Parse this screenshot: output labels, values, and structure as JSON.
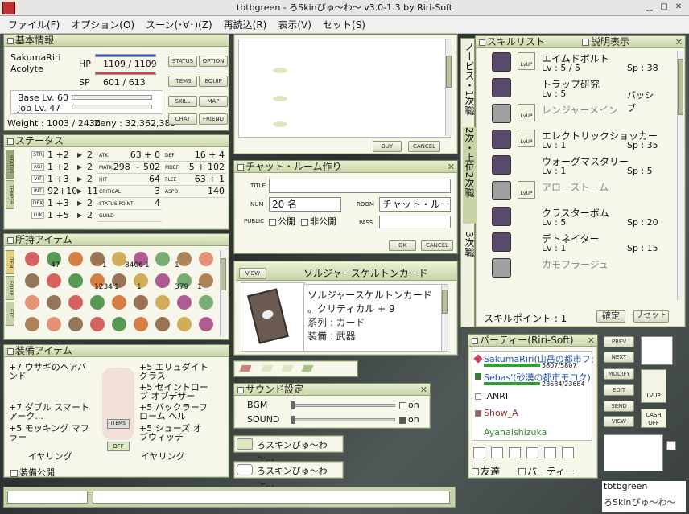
{
  "window": {
    "title": "tbtbgreen - ろSkinぴゅ～わ～ v3.0-1.3 by Riri-Soft"
  },
  "menu": [
    "ファイル(F)",
    "オプション(O)",
    "スーン(･∀･)(Z)",
    "再読込(R)",
    "表示(V)",
    "セット(S)"
  ],
  "basic": {
    "title": "基本情報",
    "name": "SakumaRiri",
    "job": "Acolyte",
    "hp_label": "HP",
    "hp": "1109 / 1109",
    "sp_label": "SP",
    "sp": "601 / 613",
    "hp_frac": 1.0,
    "sp_frac": 0.98,
    "base_lv": "Base Lv. 60",
    "job_lv": "Job Lv. 47",
    "weight": "Weight : 1003 / 2430",
    "zeny": "Zeny : 32,362,389",
    "buttons": [
      "STATUS",
      "OPTION",
      "ITEMS",
      "EQUIP",
      "SKILL",
      "MAP",
      "CHAT",
      "FRIEND"
    ]
  },
  "status": {
    "title": "ステータス",
    "tab": "STATUS",
    "tab2": "TEMPER",
    "stats": [
      {
        "k": "STR",
        "v": "1 +2",
        "p": "2"
      },
      {
        "k": "AGI",
        "v": "1 +2",
        "p": "2"
      },
      {
        "k": "VIT",
        "v": "1 +3",
        "p": "2"
      },
      {
        "k": "INT",
        "v": "92+10",
        "p": "11"
      },
      {
        "k": "DEX",
        "v": "1 +3",
        "p": "2"
      },
      {
        "k": "LUK",
        "v": "1 +5",
        "p": "2"
      }
    ],
    "left": [
      {
        "k": "ATK",
        "v": "63 + 0"
      },
      {
        "k": "MATK",
        "v": "298 ~ 502"
      },
      {
        "k": "HIT",
        "v": "64"
      },
      {
        "k": "CRITICAL",
        "v": "3"
      },
      {
        "k": "STATUS POINT",
        "v": "4"
      },
      {
        "k": "GUILD",
        "v": ""
      }
    ],
    "right": [
      {
        "k": "DEF",
        "v": "16 + 4"
      },
      {
        "k": "MDEF",
        "v": "5 + 102"
      },
      {
        "k": "FLEE",
        "v": "63 + 1"
      },
      {
        "k": "ASPD",
        "v": "140"
      }
    ]
  },
  "items": {
    "title": "所持アイテム",
    "tabs": [
      "ITEM",
      "EQUIP",
      "ETC"
    ],
    "counts": [
      "47",
      "1",
      "8406",
      "1",
      "1",
      "1234",
      "1",
      "1",
      "379",
      "1"
    ]
  },
  "equip": {
    "title": "装備アイテム",
    "left": [
      "+7 ウサギのヘアバンド",
      "+7 ダブル スマート アーク...",
      "+5 モッキング マフラー",
      "イヤリング"
    ],
    "right": [
      "+5 エリュダイト グラス",
      "+5 セイントローブ オブデザー",
      "+5 バックラーフローム ヘル",
      "+5 シューズ オブウィッチ",
      "イヤリング"
    ],
    "items_label": "ITEMS",
    "off_label": "OFF",
    "public": "装備公開"
  },
  "shop": {
    "buy": "BUY",
    "cancel": "CANCEL"
  },
  "chat": {
    "title": "チャット・ルーム作り",
    "title_label": "TITLE",
    "num_label": "NUM",
    "num": "20 名",
    "room_label": "ROOM",
    "room": "チャット・ルー",
    "public_label": "PUBLIC",
    "open": "公開",
    "closed": "非公開",
    "pass_label": "PASS",
    "ok": "OK",
    "cancel": "CANCEL"
  },
  "card": {
    "title": "ソルジャースケルトンカード",
    "view": "VIEW",
    "name": "ソルジャースケルトンカード",
    "effect": "。クリティカル + 9",
    "series": "系列 : カード",
    "slot": "装備 : 武器"
  },
  "sound": {
    "title": "サウンド設定",
    "bgm": "BGM",
    "sound": "SOUND",
    "on": "on",
    "bgm_level": 0.0,
    "sound_level": 0.0
  },
  "notes": [
    "ろスキンぴゅ～わ～...",
    "ろスキンぴゅ～わ～..."
  ],
  "skill": {
    "title": "スキルリスト",
    "desc": "説明表示",
    "tabs": [
      "ノービス・1次職",
      "2次・上位2次職",
      "3次職"
    ],
    "rows": [
      {
        "n": "エイムドボルト",
        "lv": "Lv :  5  /  5",
        "sp": "Sp : 38",
        "up": true
      },
      {
        "n": "トラップ研究",
        "lv": "Lv : 5",
        "sp": "パッシブ",
        "up": false
      },
      {
        "n": "レンジャーメイン",
        "lv": "",
        "sp": "",
        "up": true
      },
      {
        "n": "エレクトリックショッカー",
        "lv": "Lv : 1",
        "sp": "Sp : 35",
        "up": true
      },
      {
        "n": "ウォーグマスタリー",
        "lv": "Lv : 1",
        "sp": "Sp : 5",
        "up": false
      },
      {
        "n": "アローストーム",
        "lv": "",
        "sp": "",
        "up": true
      },
      {
        "n": "クラスターボム",
        "lv": "Lv : 5",
        "sp": "Sp : 20",
        "up": false
      },
      {
        "n": "デトネイター",
        "lv": "Lv : 1",
        "sp": "Sp : 15",
        "up": false
      },
      {
        "n": "カモフラージュ",
        "lv": "",
        "sp": "",
        "up": false
      }
    ],
    "points": "スキルポイント : 1",
    "confirm": "確定",
    "reset": "リセット"
  },
  "party": {
    "title": "パーティー(Riri-Soft)",
    "m1": "SakumaRiri(山岳の都市フェ",
    "m1hp": "5807/5807",
    "m2": "Sebas'(砂漠の都市モロク)",
    "m2hp": "23684/23684",
    "m3": ".ANRI",
    "m4": "Show_A",
    "m5": "AyanaIshizuka",
    "friend": "友達",
    "party": "パーティー"
  },
  "side": {
    "buttons": [
      "PREV",
      "NEXT",
      "MODIFY",
      "EDIT",
      "SEND",
      "VIEW"
    ],
    "lvup": "LVUP",
    "cash": "CASH OFF"
  },
  "footer": {
    "name": "tbtbgreen",
    "skin": "ろSkinぴゅ～わ～"
  }
}
